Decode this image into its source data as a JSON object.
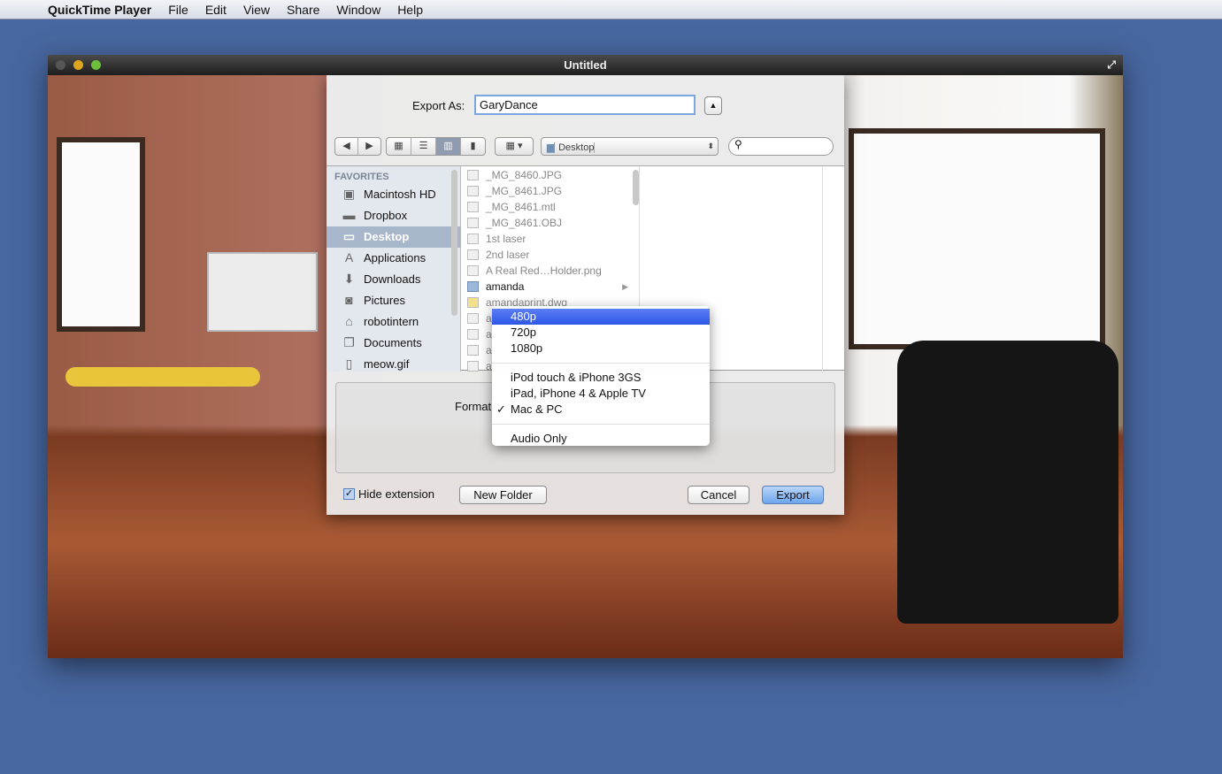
{
  "menubar": {
    "apple": "",
    "app": "QuickTime Player",
    "items": [
      "File",
      "Edit",
      "View",
      "Share",
      "Window",
      "Help"
    ]
  },
  "window": {
    "title": "Untitled"
  },
  "dialog": {
    "export_as_label": "Export As:",
    "export_as_value": "GaryDance",
    "location": "Desktop",
    "search_placeholder": "",
    "sidebar": {
      "header": "FAVORITES",
      "items": [
        {
          "label": "Macintosh HD",
          "icon": "hard-drive-icon"
        },
        {
          "label": "Dropbox",
          "icon": "folder-icon"
        },
        {
          "label": "Desktop",
          "icon": "desktop-icon",
          "selected": true
        },
        {
          "label": "Applications",
          "icon": "applications-icon"
        },
        {
          "label": "Downloads",
          "icon": "downloads-icon"
        },
        {
          "label": "Pictures",
          "icon": "camera-icon"
        },
        {
          "label": "robotintern",
          "icon": "home-icon"
        },
        {
          "label": "Documents",
          "icon": "documents-icon"
        },
        {
          "label": "meow.gif",
          "icon": "file-icon"
        }
      ]
    },
    "files": [
      {
        "name": "_MG_8460.JPG"
      },
      {
        "name": "_MG_8461.JPG"
      },
      {
        "name": "_MG_8461.mtl"
      },
      {
        "name": "_MG_8461.OBJ"
      },
      {
        "name": "1st laser"
      },
      {
        "name": "2nd laser"
      },
      {
        "name": "A Real Red…Holder.png"
      },
      {
        "name": "amanda",
        "folder": true
      },
      {
        "name": "amandaprint.dwg"
      },
      {
        "name": "a"
      },
      {
        "name": "a"
      },
      {
        "name": "a"
      },
      {
        "name": "a"
      }
    ],
    "format_label": "Format",
    "format_menu": {
      "groups": [
        [
          "480p",
          "720p",
          "1080p"
        ],
        [
          "iPod touch & iPhone 3GS",
          "iPad, iPhone 4 & Apple TV",
          "Mac & PC"
        ],
        [
          "Audio Only"
        ]
      ],
      "highlighted": "480p",
      "checked": "Mac & PC",
      "check_mark": "✓"
    },
    "hide_extension_label": "Hide extension",
    "hide_extension_checked": true,
    "new_folder": "New Folder",
    "cancel": "Cancel",
    "export": "Export"
  }
}
